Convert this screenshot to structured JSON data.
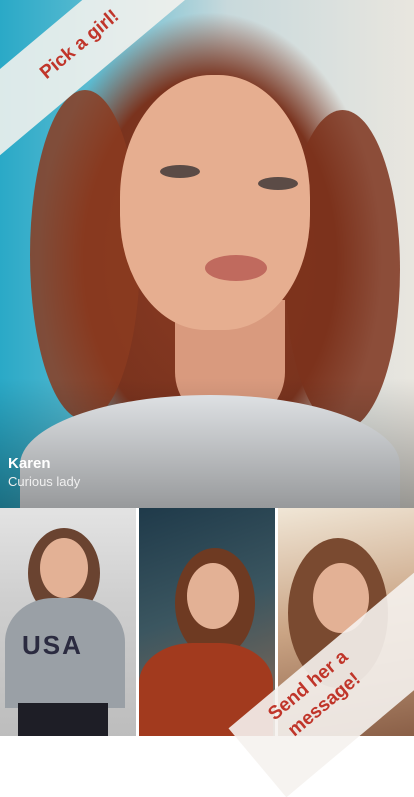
{
  "profile": {
    "name": "Karen",
    "tagline": "Curious lady"
  },
  "banners": {
    "top_left": "Pick a girl!",
    "bottom_right_line1": "Send her a",
    "bottom_right_line2": "message!"
  },
  "thumbnails": [
    {
      "shirt_text": "USA"
    },
    {},
    {}
  ],
  "colors": {
    "banner_text": "#c0352a",
    "banner_bg": "#f5f2ee"
  }
}
